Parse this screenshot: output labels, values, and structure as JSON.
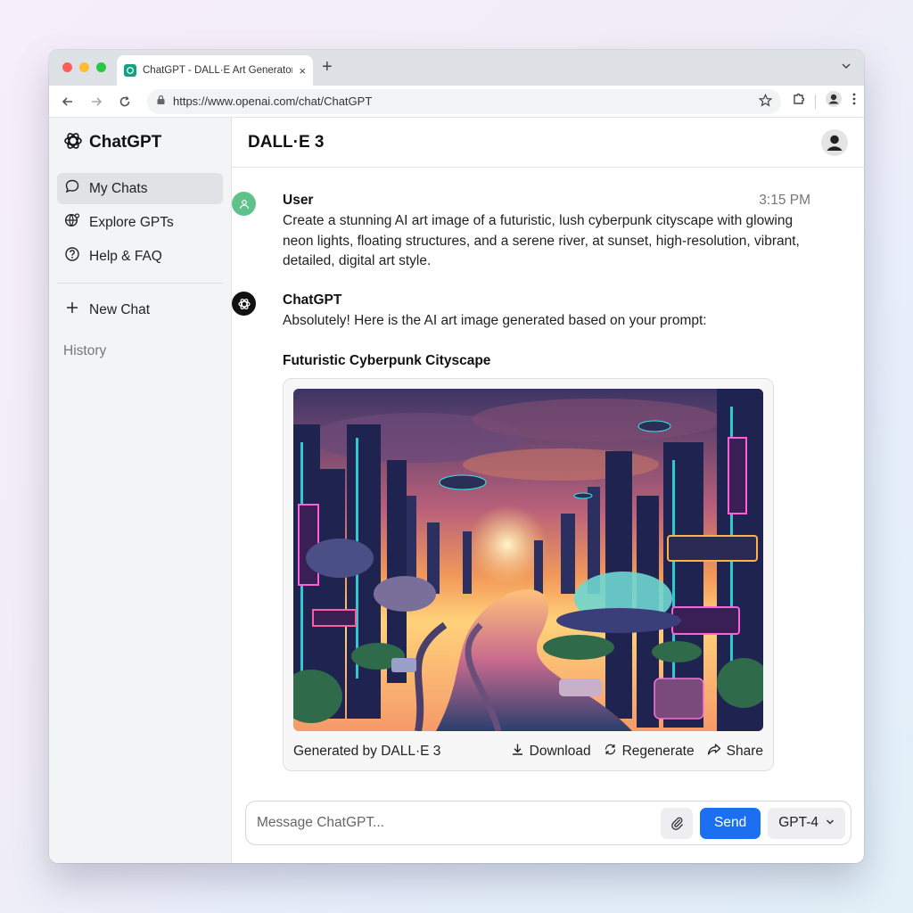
{
  "browser": {
    "tab_title": "ChatGPT - DALL·E Art Generator",
    "tab_close": "×",
    "new_tab": "+",
    "url": "https://www.openai.com/chat/ChatGPT"
  },
  "sidebar": {
    "brand": "ChatGPT",
    "items": [
      {
        "label": "My Chats",
        "icon": "chat-bubble-icon",
        "active": true
      },
      {
        "label": "Explore GPTs",
        "icon": "globe-icon"
      },
      {
        "label": "Help & FAQ",
        "icon": "help-icon"
      }
    ],
    "new_chat": "New Chat",
    "history": "History"
  },
  "main": {
    "title": "DALL·E 3"
  },
  "messages": {
    "user": {
      "name": "User",
      "time": "3:15 PM",
      "text": "Create a stunning AI art image of a futuristic, lush cyberpunk cityscape with glowing neon lights, floating structures, and a serene river, at sunset, high-resolution, vibrant, detailed, digital art style."
    },
    "assistant": {
      "name": "ChatGPT",
      "text": "Absolutely! Here is the AI art image generated based on your prompt:",
      "image_title": "Futuristic Cyberpunk Cityscape",
      "generated_by": "Generated by DALL·E 3",
      "actions": {
        "download": "Download",
        "regenerate": "Regenerate",
        "share": "Share"
      }
    }
  },
  "composer": {
    "placeholder": "Message ChatGPT...",
    "send": "Send",
    "model": "GPT-4"
  },
  "colors": {
    "accent": "#1d6ff2",
    "user_avatar": "#5ec28a",
    "brand_green": "#10a37f"
  }
}
